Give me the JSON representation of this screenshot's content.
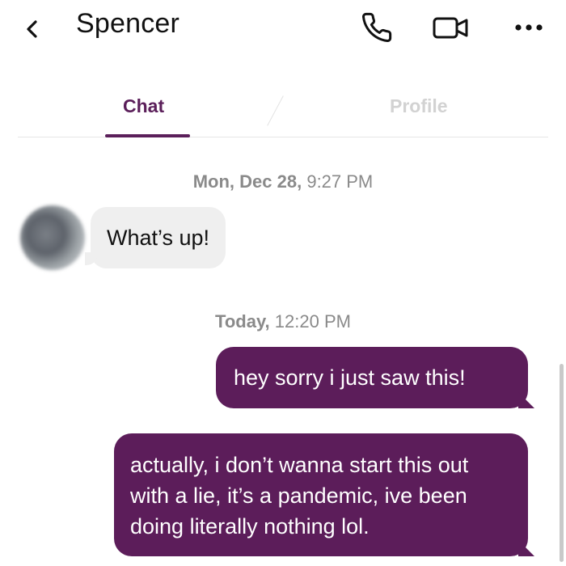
{
  "header": {
    "back_icon": "chevron-left-icon",
    "contact_name": "Spencer",
    "call_icon": "phone-icon",
    "video_icon": "video-camera-icon",
    "more_icon": "more-dots-icon"
  },
  "tabs": [
    {
      "label": "Chat",
      "active": true
    },
    {
      "label": "Profile",
      "active": false
    }
  ],
  "conversation": {
    "groups": [
      {
        "timestamp_day": "Mon, Dec 28,",
        "timestamp_time": "9:27 PM",
        "messages": [
          {
            "direction": "incoming",
            "text": "What’s up!"
          }
        ]
      },
      {
        "timestamp_day": "Today,",
        "timestamp_time": "12:20 PM",
        "messages": [
          {
            "direction": "outgoing",
            "text": "hey sorry i just saw this!"
          },
          {
            "direction": "outgoing",
            "text": "actually, i don’t wanna start this out with a lie, it’s a pandemic, ive been doing literally nothing lol."
          }
        ]
      }
    ]
  },
  "colors": {
    "accent": "#5c1d5a",
    "incoming_bubble": "#efefef",
    "timestamp_text": "#8a8a8a",
    "inactive_tab": "#d2d2d2"
  }
}
